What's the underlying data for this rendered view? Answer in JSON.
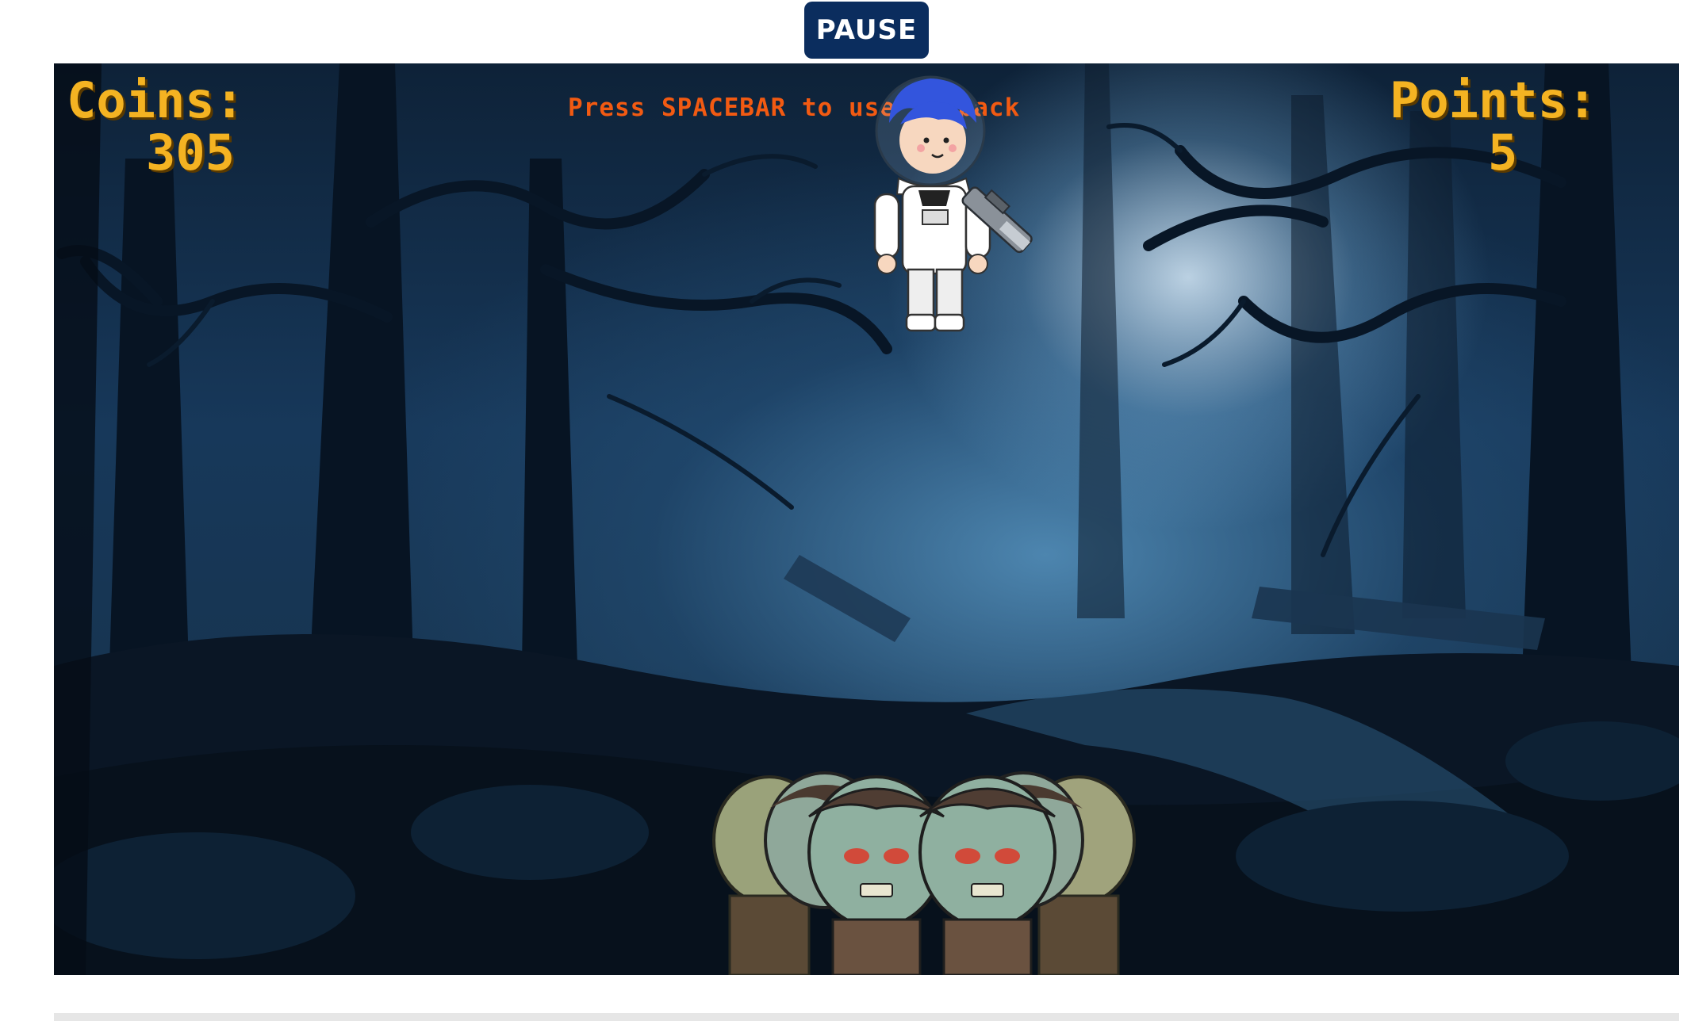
{
  "controls": {
    "pause_label": "PAUSE"
  },
  "hud": {
    "coins_label": "Coins:",
    "coins_value": "305",
    "points_label": "Points:",
    "points_value": "5",
    "hint": "Press SPACEBAR to use Jetpack"
  },
  "scene": {
    "background": "haunted-forest",
    "player": "astronaut-with-jetpack",
    "enemies": "zombie-horde"
  },
  "colors": {
    "hud_text": "#f4b322",
    "hint_text": "#f25a12",
    "pause_button": "#0b2d5e"
  }
}
